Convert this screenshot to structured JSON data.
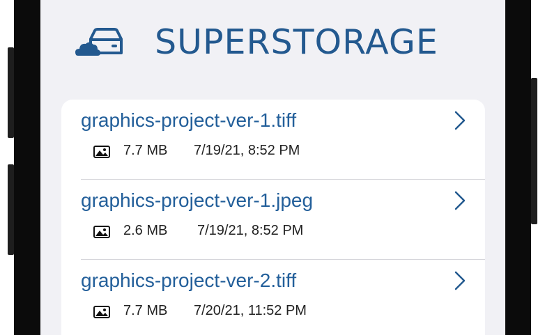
{
  "app": {
    "brand": "SUPERSTORAGE",
    "accent_color": "#23598f",
    "logo_icon": "cloud-car-icon"
  },
  "files": [
    {
      "name": "graphics-project-ver-1.tiff",
      "size": "7.7 MB",
      "date": "7/19/21, 8:52 PM",
      "icon": "image-icon"
    },
    {
      "name": "graphics-project-ver-1.jpeg",
      "size": "2.6 MB",
      "date": "7/19/21, 8:52 PM",
      "icon": "image-icon"
    },
    {
      "name": "graphics-project-ver-2.tiff",
      "size": "7.7 MB",
      "date": "7/20/21, 11:52 PM",
      "icon": "image-icon"
    }
  ]
}
